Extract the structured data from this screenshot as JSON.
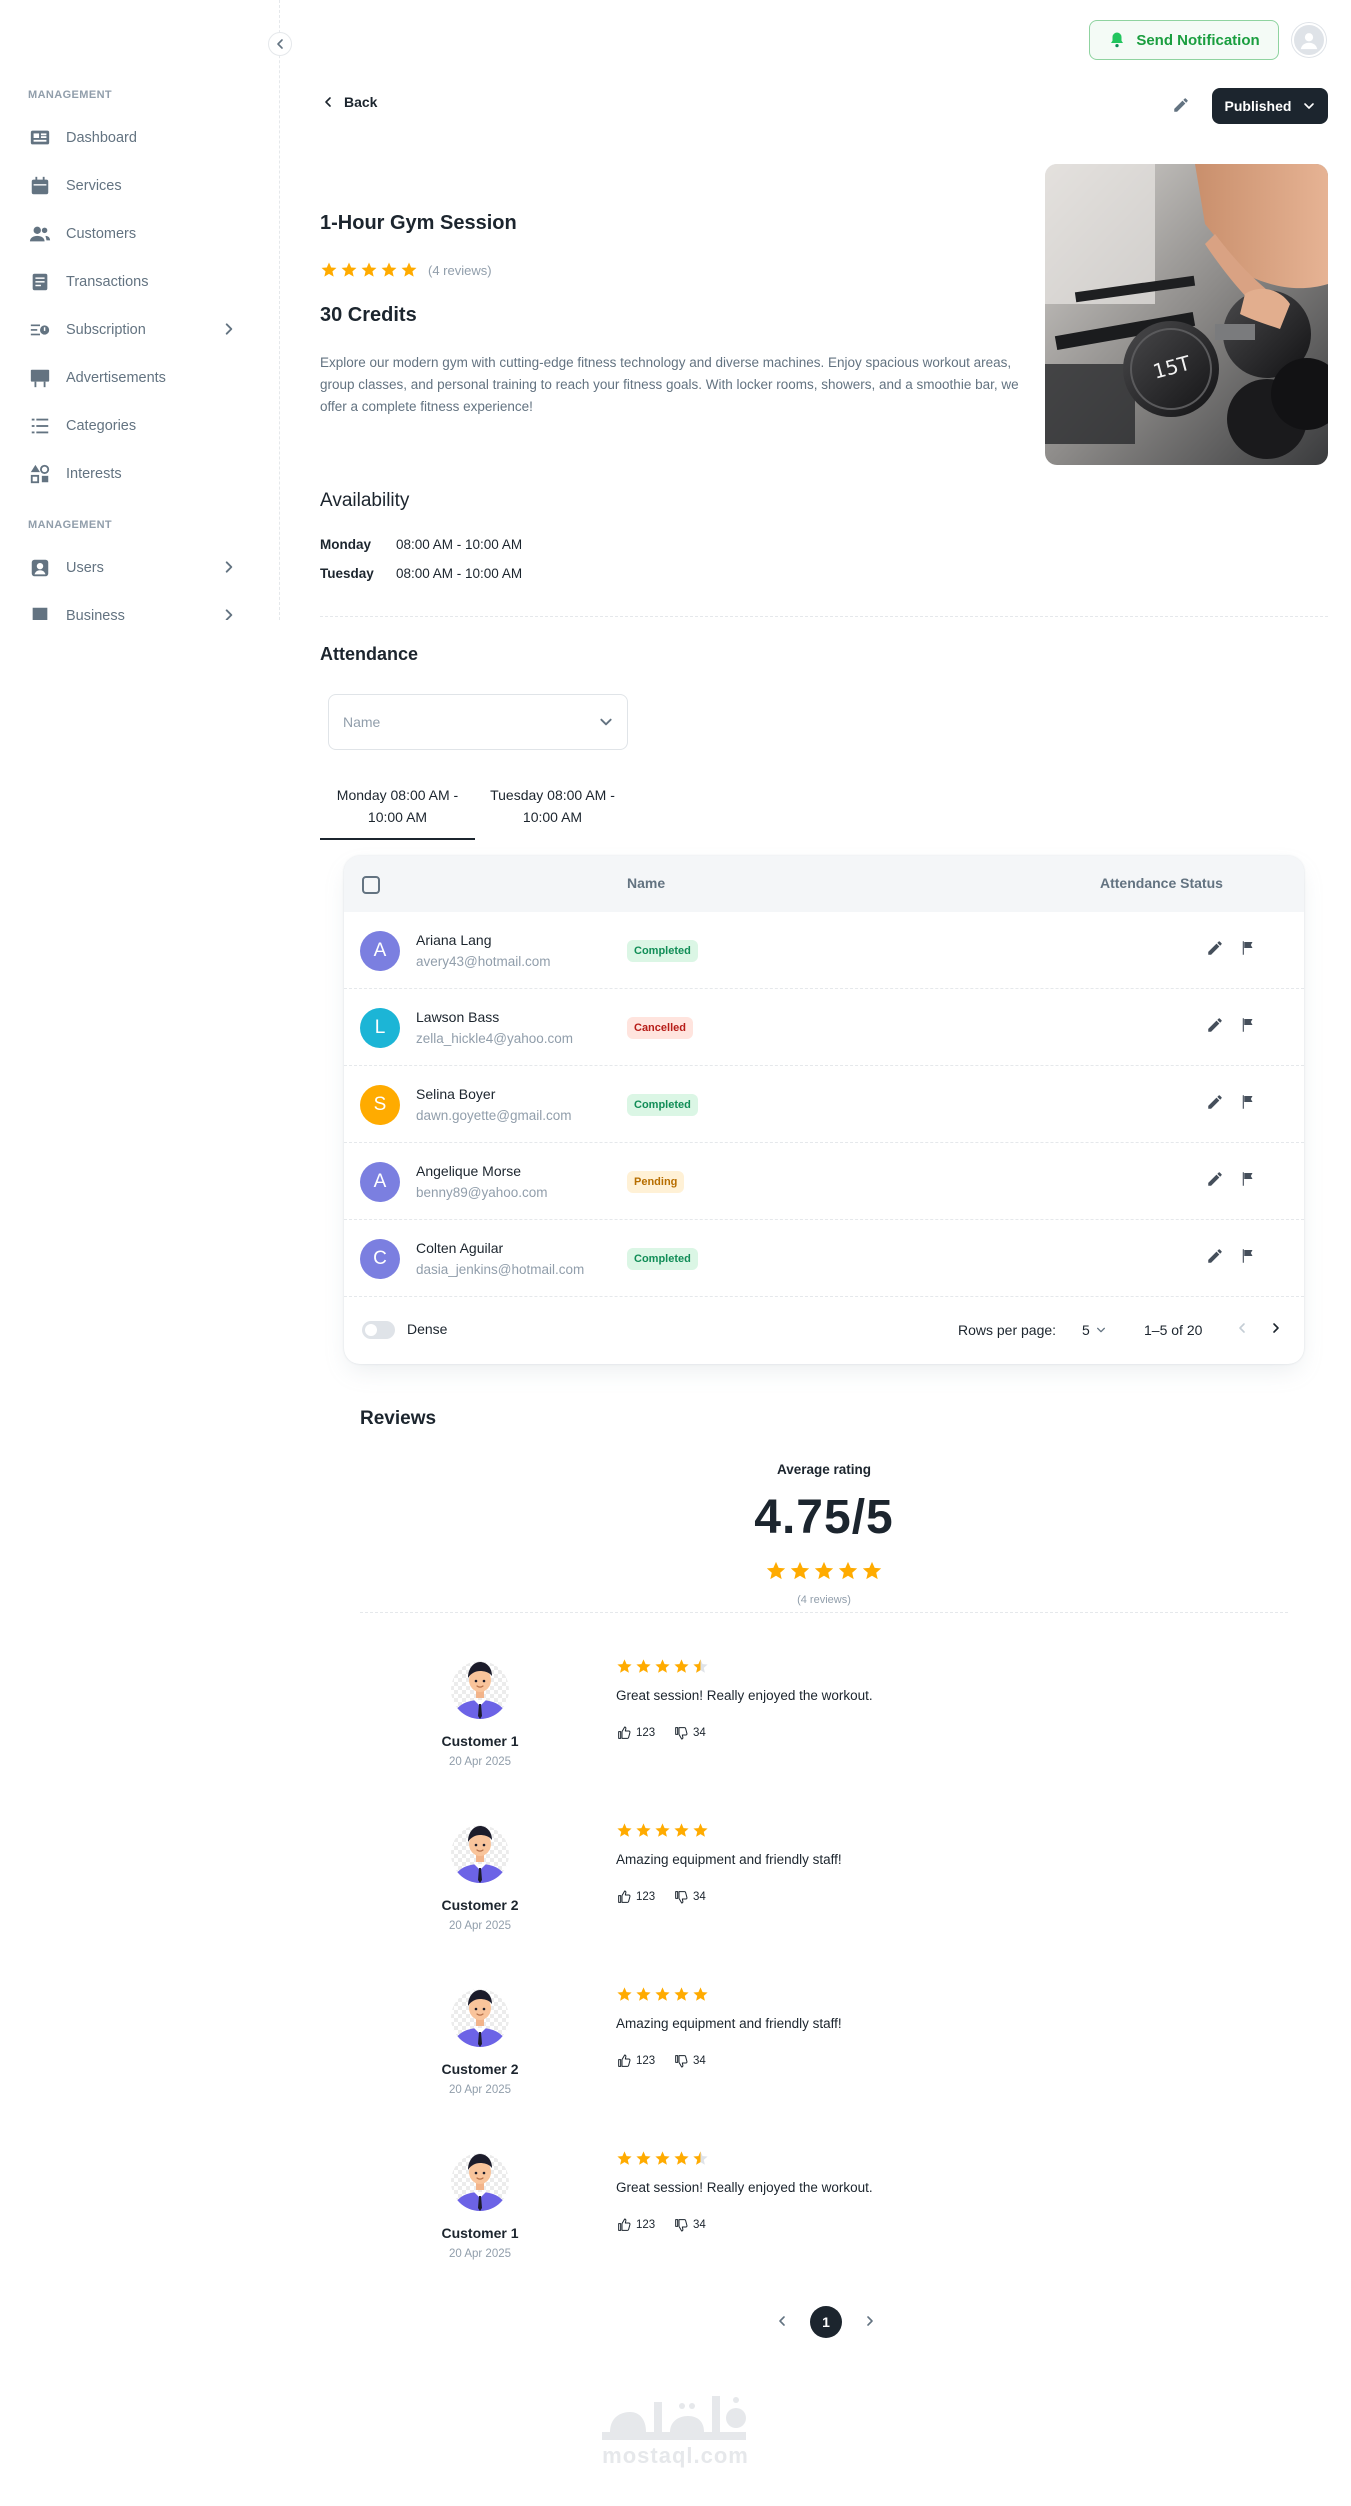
{
  "sidebar": {
    "subheader_1": "MANAGEMENT",
    "subheader_2": "MANAGEMENT",
    "items": [
      {
        "label": "Dashboard",
        "icon": "dashboard-icon"
      },
      {
        "label": "Services",
        "icon": "calendar-icon"
      },
      {
        "label": "Customers",
        "icon": "users-icon"
      },
      {
        "label": "Transactions",
        "icon": "invoice-icon"
      },
      {
        "label": "Subscription",
        "icon": "subscription-icon",
        "has_children": true
      },
      {
        "label": "Advertisements",
        "icon": "billboard-icon"
      },
      {
        "label": "Categories",
        "icon": "list-icon"
      },
      {
        "label": "Interests",
        "icon": "shapes-icon"
      }
    ],
    "items_2": [
      {
        "label": "Users",
        "icon": "user-card-icon",
        "has_children": true
      },
      {
        "label": "Business",
        "icon": "building-icon",
        "has_children": true
      }
    ]
  },
  "header": {
    "notification_label": "Send Notification",
    "back_label": "Back",
    "status_label": "Published"
  },
  "product": {
    "title": "1-Hour Gym Session",
    "rating": 5,
    "reviews_text": "(4 reviews)",
    "credits": "30 Credits",
    "description": "Explore our modern gym with cutting-edge fitness technology and diverse machines. Enjoy spacious workout areas, group classes, and personal training to reach your fitness goals. With locker rooms, showers, and a smoothie bar, we offer a complete fitness experience!"
  },
  "availability": {
    "title": "Availability",
    "rows": [
      {
        "day": "Monday",
        "time": "08:00 AM - 10:00 AM"
      },
      {
        "day": "Tuesday",
        "time": "08:00 AM - 10:00 AM"
      }
    ]
  },
  "attendance": {
    "title": "Attendance",
    "name_placeholder": "Name",
    "tabs": [
      {
        "label": "Monday 08:00 AM - 10:00 AM",
        "active": true
      },
      {
        "label": "Tuesday 08:00 AM - 10:00 AM",
        "active": false
      }
    ],
    "columns": {
      "name": "Name",
      "status": "Attendance Status"
    },
    "rows": [
      {
        "initial": "A",
        "name": "Ariana Lang",
        "email": "avery43@hotmail.com",
        "status": "Completed",
        "status_key": "completed",
        "color": "#7b7fe0"
      },
      {
        "initial": "L",
        "name": "Lawson Bass",
        "email": "zella_hickle4@yahoo.com",
        "status": "Cancelled",
        "status_key": "cancelled",
        "color": "#1cb5d6"
      },
      {
        "initial": "S",
        "name": "Selina Boyer",
        "email": "dawn.goyette@gmail.com",
        "status": "Completed",
        "status_key": "completed",
        "color": "#ffab00"
      },
      {
        "initial": "A",
        "name": "Angelique Morse",
        "email": "benny89@yahoo.com",
        "status": "Pending",
        "status_key": "pending",
        "color": "#7b7fe0"
      },
      {
        "initial": "C",
        "name": "Colten Aguilar",
        "email": "dasia_jenkins@hotmail.com",
        "status": "Completed",
        "status_key": "completed",
        "color": "#7b7fe0"
      }
    ],
    "footer": {
      "dense_label": "Dense",
      "rows_per_page_label": "Rows per page:",
      "rows_per_page": "5",
      "range": "1–5 of 20"
    }
  },
  "reviews": {
    "title": "Reviews",
    "average_label": "Average rating",
    "average_value": "4.75/5",
    "average_stars": 5,
    "count_text": "(4 reviews)",
    "items": [
      {
        "name": "Customer 1",
        "date": "20 Apr 2025",
        "rating": 4.5,
        "text": "Great session! Really enjoyed the workout.",
        "likes": "123",
        "dislikes": "34"
      },
      {
        "name": "Customer 2",
        "date": "20 Apr 2025",
        "rating": 5,
        "text": "Amazing equipment and friendly staff!",
        "likes": "123",
        "dislikes": "34"
      },
      {
        "name": "Customer 2",
        "date": "20 Apr 2025",
        "rating": 5,
        "text": "Amazing equipment and friendly staff!",
        "likes": "123",
        "dislikes": "34"
      },
      {
        "name": "Customer 1",
        "date": "20 Apr 2025",
        "rating": 4.5,
        "text": "Great session! Really enjoyed the workout.",
        "likes": "123",
        "dislikes": "34"
      }
    ],
    "current_page": "1"
  },
  "watermark": {
    "arabic": "مستقل",
    "latin": "mostaql.com"
  },
  "colors": {
    "accent_dark": "#1c252e",
    "star": "#ffab00",
    "notification_green": "#1a9e3f"
  }
}
